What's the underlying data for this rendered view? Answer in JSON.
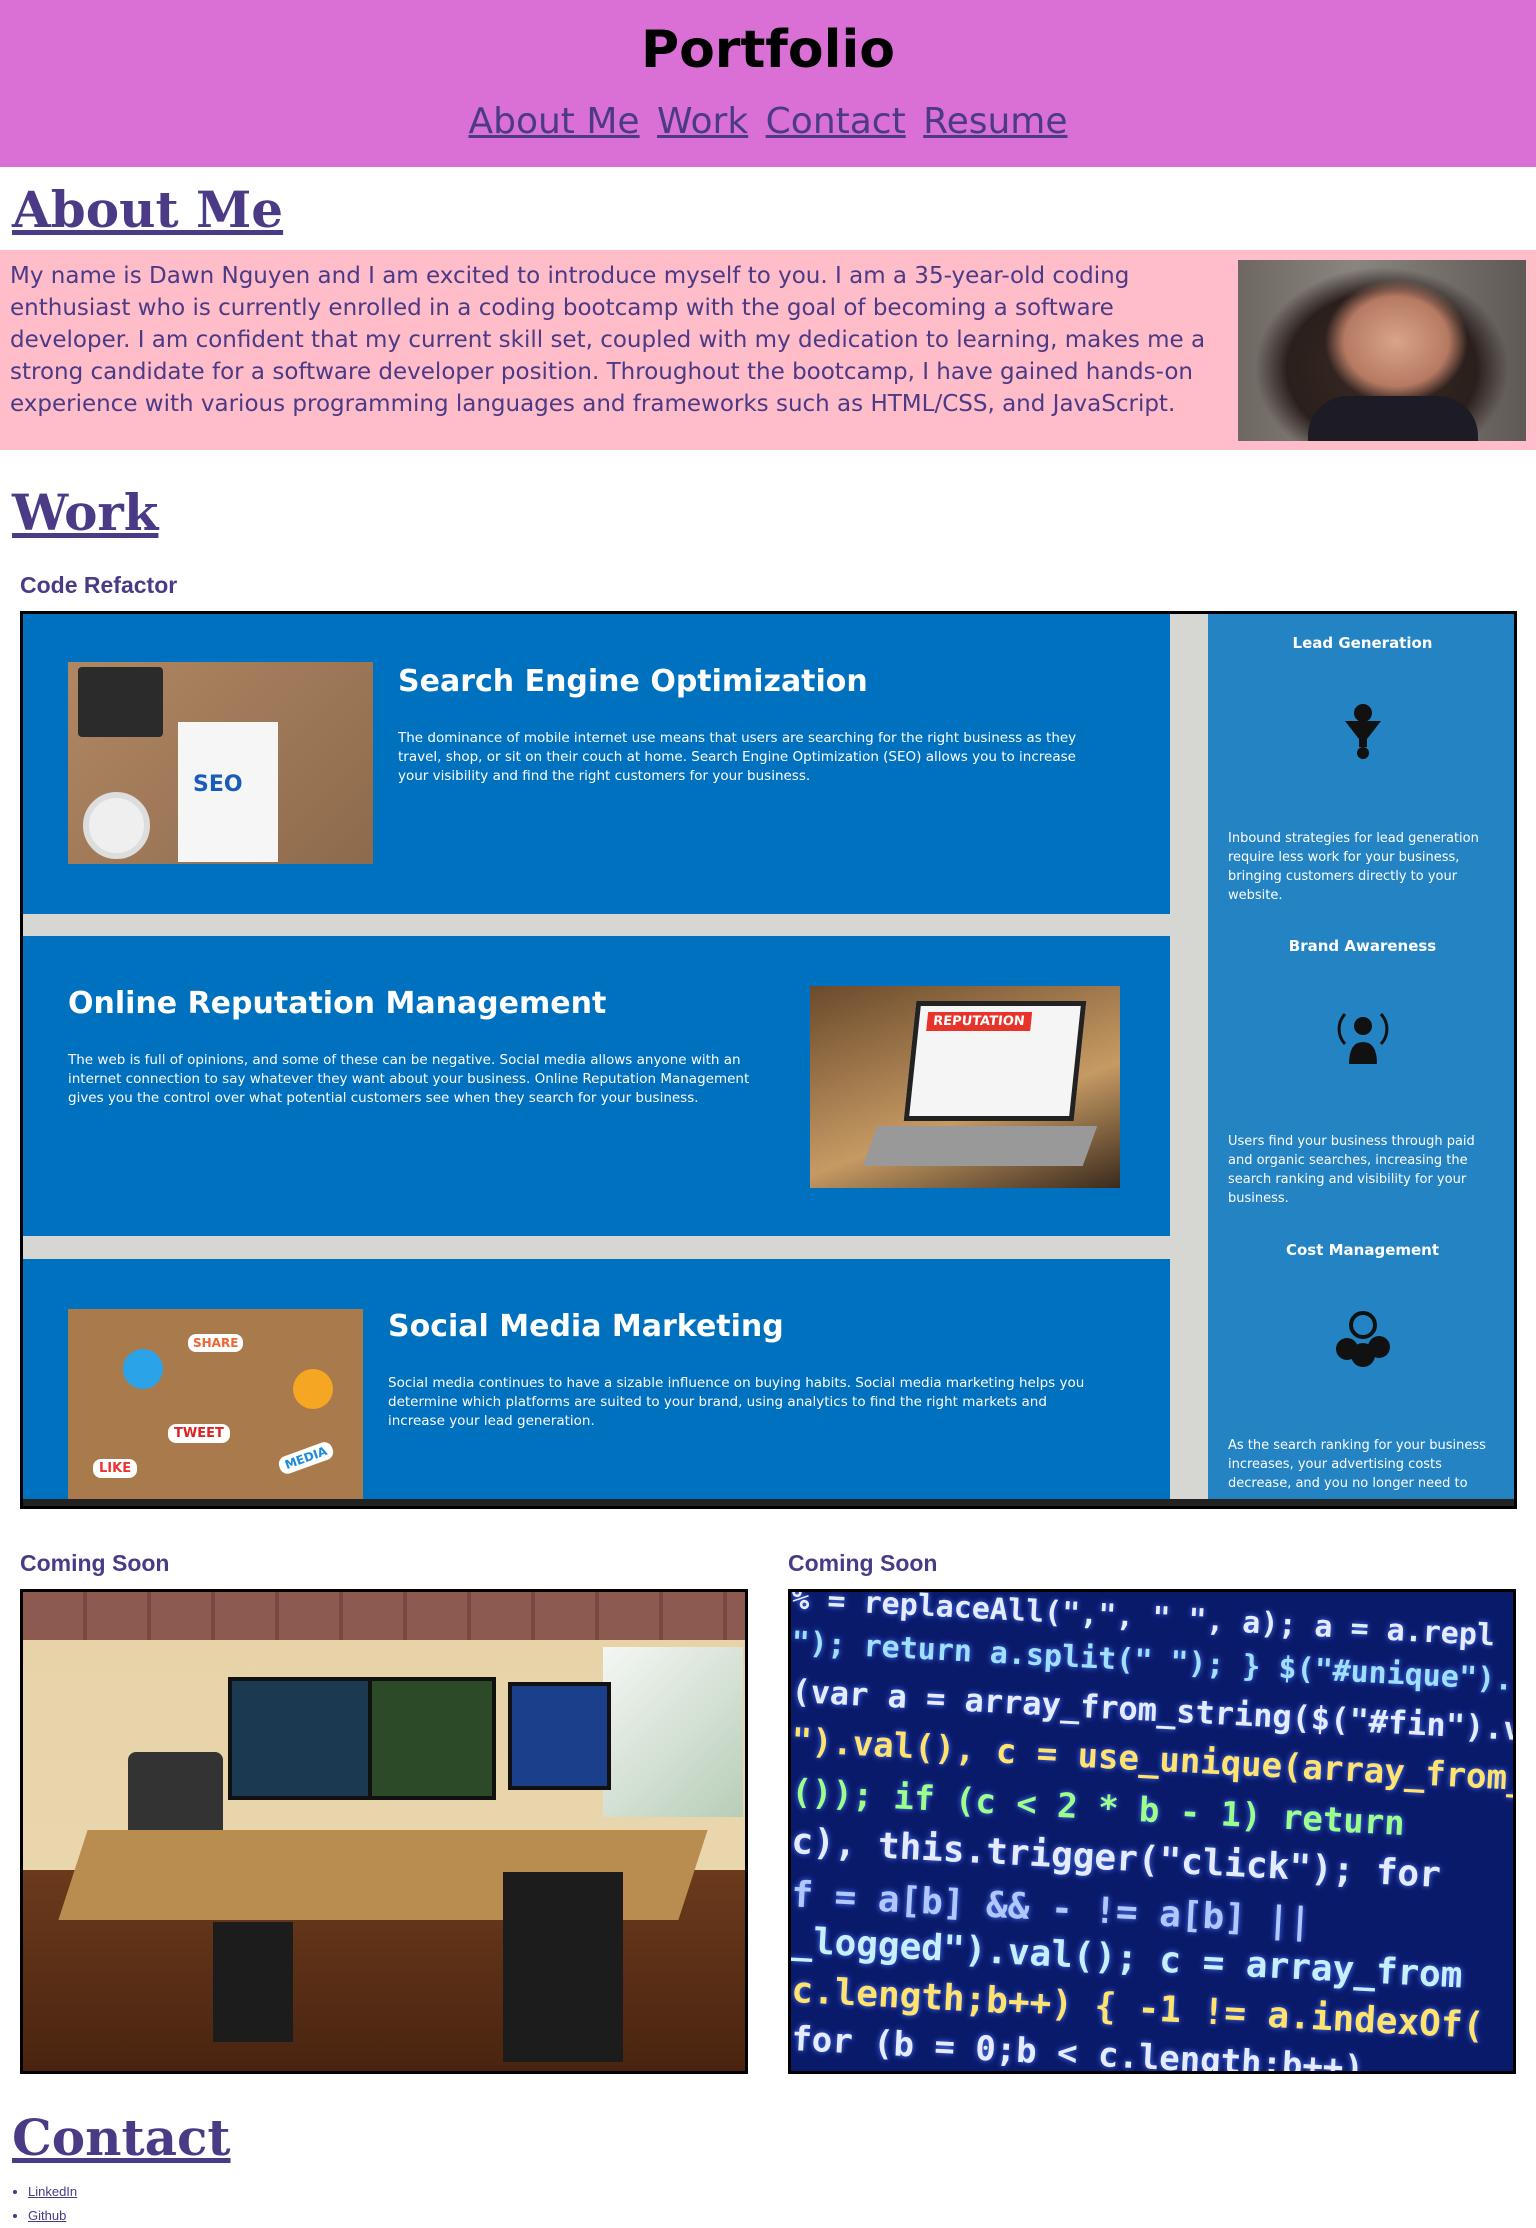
{
  "header": {
    "title": "Portfolio",
    "nav": [
      {
        "label": "About Me"
      },
      {
        "label": "Work"
      },
      {
        "label": "Contact"
      },
      {
        "label": "Resume"
      }
    ]
  },
  "about": {
    "heading": "About Me",
    "text": "My name is Dawn Nguyen and I am excited to introduce myself to you. I am a 35-year-old coding enthusiast who is currently enrolled in a coding bootcamp with the goal of becoming a software developer. I am confident that my current skill set, coupled with my dedication to learning, makes me a strong candidate for a software developer position. Throughout the bootcamp, I have gained hands-on experience with various programming languages and frameworks such as HTML/CSS, and JavaScript."
  },
  "work": {
    "heading": "Work",
    "projects": [
      {
        "label": "Code Refactor",
        "panels": [
          {
            "title": "Search Engine Optimization",
            "text": "The dominance of mobile internet use means that users are searching for the right business as they travel, shop, or sit on their couch at home. Search Engine Optimization (SEO) allows you to increase your visibility and find the right customers for your business.",
            "thumb_text": "SEO"
          },
          {
            "title": "Online Reputation Management",
            "text": "The web is full of opinions, and some of these can be negative. Social media allows anyone with an internet connection to say whatever they want about your business. Online Reputation Management gives you the control over what potential customers see when they search for your business.",
            "thumb_text": "REPUTATION"
          },
          {
            "title": "Social Media Marketing",
            "text": "Social media continues to have a sizable influence on buying habits. Social media marketing helps you determine which platforms are suited to your brand, using analytics to find the right markets and increase your lead generation.",
            "thumb_text": [
              "SHARE",
              "TWEET",
              "LIKE",
              "MEDIA"
            ]
          }
        ],
        "sidebar": [
          {
            "title": "Lead Generation",
            "text": "Inbound strategies for lead generation require less work for your business, bringing customers directly to your website.",
            "icon": "funnel-icon"
          },
          {
            "title": "Brand Awareness",
            "text": "Users find your business through paid and organic searches, increasing the search ranking and visibility for your business.",
            "icon": "broadcast-icon"
          },
          {
            "title": "Cost Management",
            "text": "As the search ranking for your business increases, your advertising costs decrease, and you no longer need to",
            "icon": "coins-gear-icon"
          }
        ]
      },
      {
        "label": "Coming Soon"
      },
      {
        "label": "Coming Soon"
      }
    ]
  },
  "contact": {
    "heading": "Contact",
    "links": [
      {
        "label": "LinkedIn"
      },
      {
        "label": "Github"
      }
    ]
  },
  "colors": {
    "header_bg": "#da70d6",
    "about_bg": "#ffbcc9",
    "text": "#4b3a86",
    "panel_blue": "#0071bf",
    "sidebar_blue": "#2383c3"
  }
}
